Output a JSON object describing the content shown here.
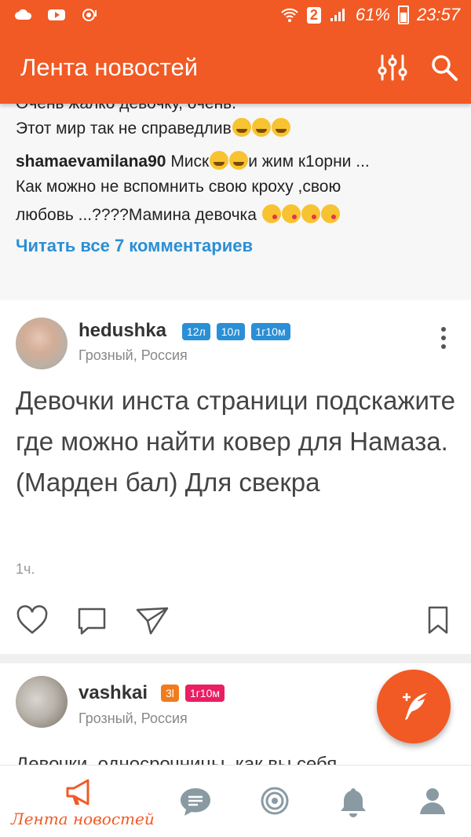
{
  "status_bar": {
    "sim": "2",
    "battery": "61%",
    "time": "23:57"
  },
  "header": {
    "title": "Лента новостей"
  },
  "comments": {
    "line1": "Очень жалко девочку, очень.",
    "line2": "Этот мир так не справедлив",
    "comment2_user": "shamaevamilana90",
    "comment2_line1_a": "Миск",
    "comment2_line1_b": "и жим к1орни ...",
    "comment2_line2": "Как можно не вспомнить свою кроху  ,свою",
    "comment2_line3": "любовь ...????Мамина девочка",
    "read_all": "Читать все 7 комментариев"
  },
  "posts": [
    {
      "username": "hedushka",
      "badges": [
        {
          "text": "12л",
          "color": "#2a8fd6"
        },
        {
          "text": "10л",
          "color": "#2a8fd6"
        },
        {
          "text": "1г10м",
          "color": "#2a8fd6"
        }
      ],
      "location": "Грозный, Россия",
      "text": "Девочки инста страници подскажите где можно найти ковер для Намаза. (Марден бал) Для свекра",
      "time": "1ч."
    },
    {
      "username": "vashkai",
      "badges": [
        {
          "text": "3l",
          "color": "#f07c1e"
        },
        {
          "text": "1г10м",
          "color": "#e91e63"
        }
      ],
      "location": "Грозный, Россия",
      "text": "Девочки, односрочницы, как вы себя"
    }
  ],
  "bottom_nav": {
    "feed_label": "Лента новостей",
    "items": [
      "megaphone-icon",
      "chat-icon",
      "target-icon",
      "bell-icon",
      "profile-icon"
    ]
  },
  "colors": {
    "accent": "#f15a24",
    "link": "#2a8fd6"
  }
}
